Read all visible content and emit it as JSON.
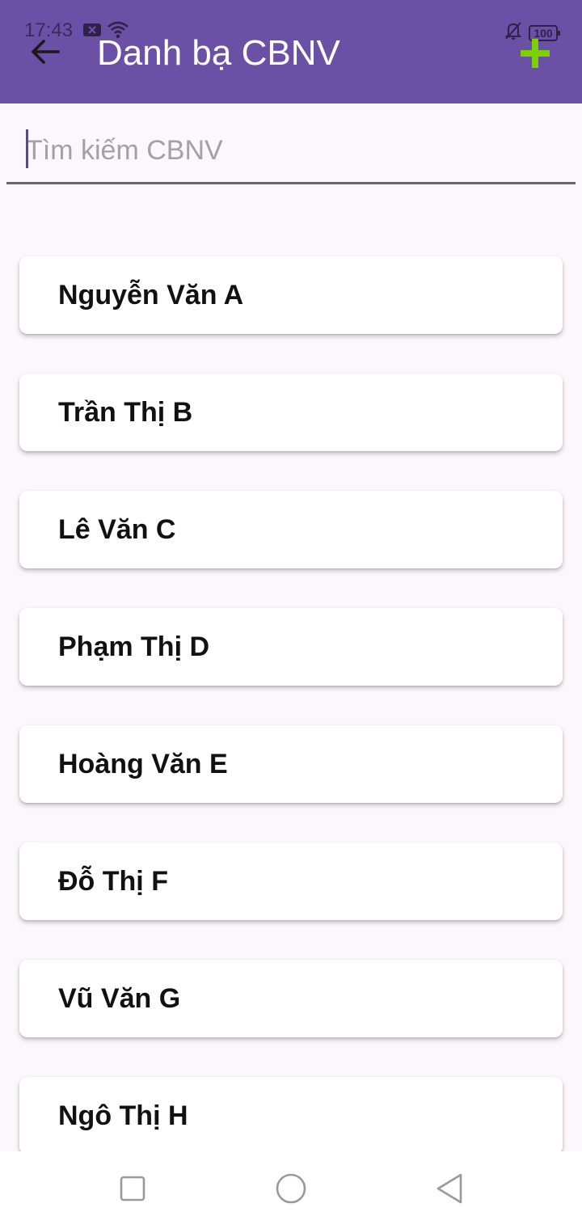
{
  "status_bar": {
    "time": "17:43",
    "battery": "100",
    "icons": [
      "notification-x-icon",
      "wifi-icon",
      "bell-off-icon",
      "battery-icon"
    ]
  },
  "appbar": {
    "title": "Danh bạ CBNV",
    "back_icon": "arrow-left-icon",
    "add_icon": "plus-icon",
    "background_color": "#6a51a6",
    "add_color": "#7cd000"
  },
  "search": {
    "placeholder": "Tìm kiếm CBNV",
    "value": ""
  },
  "contacts": [
    {
      "name": "Nguyễn Văn A"
    },
    {
      "name": "Trần Thị B"
    },
    {
      "name": "Lê Văn C"
    },
    {
      "name": "Phạm Thị D"
    },
    {
      "name": "Hoàng Văn E"
    },
    {
      "name": "Đỗ Thị F"
    },
    {
      "name": "Vũ Văn G"
    },
    {
      "name": "Ngô Thị H"
    }
  ],
  "navbar": {
    "icons": [
      "recent-apps-icon",
      "home-icon",
      "nav-back-icon"
    ]
  }
}
